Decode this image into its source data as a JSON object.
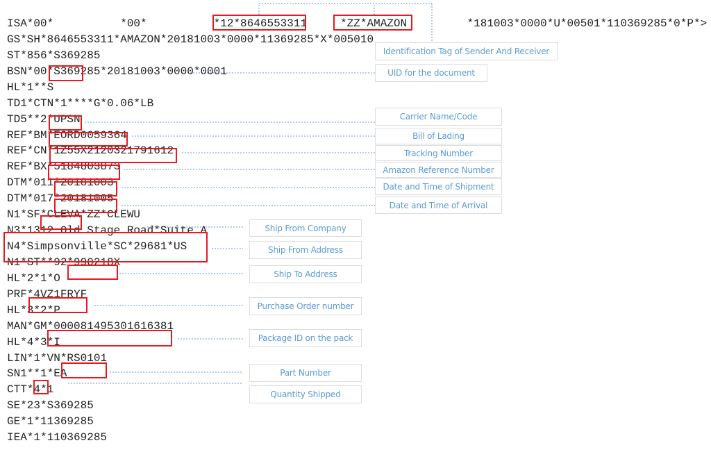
{
  "edi_lines": [
    "ISA*00*          *00*          *12*8646553311     *ZZ*AMAZON         *181003*0000*U*00501*110369285*0*P*>",
    "GS*SH*8646553311*AMAZON*20181003*0000*11369285*X*005010",
    "ST*856*S369285",
    "BSN*00*S369285*20181003*0000*0001",
    "HL*1**S",
    "TD1*CTN*1****G*0.06*LB",
    "TD5**2*UPSN",
    "REF*BM*EORD0059364",
    "REF*CN*1Z55X2120321791612",
    "REF*BX*5184803873",
    "DTM*011*20181003",
    "DTM*017*20181005",
    "N1*SF*CLEVA*ZZ*CLEWU",
    "N3*1312 Old Stage Road*Suite A",
    "N4*Simpsonville*SC*29681*US",
    "N1*ST**92*990218X",
    "HL*2*1*O",
    "PRF*4VZ1FRYF",
    "HL*3*2*P",
    "MAN*GM*000081495301616381",
    "HL*4*3*I",
    "LIN*1*VN*RS0101",
    "SN1**1*EA",
    "CTT*4*1",
    "SE*23*S369285",
    "GE*1*11369285",
    "IEA*1*110369285"
  ],
  "annotations": [
    "Identification Tag of Sender And Receiver",
    "UID for the document",
    "Carrier Name/Code",
    "Bill of Lading",
    "Tracking Number",
    "Amazon Reference Number",
    "Date and Time of Shipment",
    "Date and Time of Arrival",
    "Ship From Company",
    "Ship From Address",
    "Ship To Address",
    "Purchase Order number",
    "Package ID on the pack",
    "Part Number",
    "Quantity Shipped"
  ],
  "colors": {
    "highlight": "#e8191e",
    "annotation_text": "#5b9bd5",
    "connector": "#5b9bd5"
  }
}
